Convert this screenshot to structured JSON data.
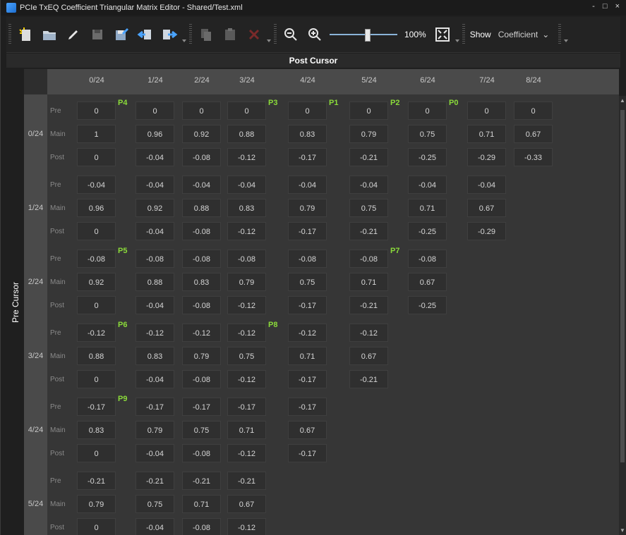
{
  "window": {
    "title": "PCIe TxEQ Coefficient Triangular Matrix Editor - Shared/Test.xml",
    "controls": "- □ ×"
  },
  "toolbar": {
    "icons": [
      "new-icon",
      "open-folder-icon",
      "edit-pencil-icon",
      "save-icon",
      "save-as-icon",
      "import-icon",
      "export-icon",
      "copy-icon",
      "paste-icon",
      "delete-icon",
      "zoom-out-icon",
      "zoom-in-icon",
      "fit-icon"
    ],
    "zoom_percent": "100%",
    "zoom_level": 0.55,
    "show_label": "Show",
    "show_value": "Coefficient"
  },
  "axes": {
    "post_cursor": "Post Cursor",
    "pre_cursor": "Pre Cursor"
  },
  "columns": [
    "0/24",
    "1/24",
    "2/24",
    "3/24",
    "4/24",
    "5/24",
    "6/24",
    "7/24",
    "8/24"
  ],
  "row_labels": [
    "Pre",
    "Main",
    "Post"
  ],
  "rows": [
    {
      "label": "0/24",
      "pre": [
        "0",
        "0",
        "0",
        "0",
        "0",
        "0",
        "0",
        "0",
        "0"
      ],
      "main": [
        "1",
        "0.96",
        "0.92",
        "0.88",
        "0.83",
        "0.79",
        "0.75",
        "0.71",
        "0.67"
      ],
      "post": [
        "0",
        "-0.04",
        "-0.08",
        "-0.12",
        "-0.17",
        "-0.21",
        "-0.25",
        "-0.29",
        "-0.33"
      ]
    },
    {
      "label": "1/24",
      "pre": [
        "-0.04",
        "-0.04",
        "-0.04",
        "-0.04",
        "-0.04",
        "-0.04",
        "-0.04",
        "-0.04"
      ],
      "main": [
        "0.96",
        "0.92",
        "0.88",
        "0.83",
        "0.79",
        "0.75",
        "0.71",
        "0.67"
      ],
      "post": [
        "0",
        "-0.04",
        "-0.08",
        "-0.12",
        "-0.17",
        "-0.21",
        "-0.25",
        "-0.29"
      ]
    },
    {
      "label": "2/24",
      "pre": [
        "-0.08",
        "-0.08",
        "-0.08",
        "-0.08",
        "-0.08",
        "-0.08",
        "-0.08"
      ],
      "main": [
        "0.92",
        "0.88",
        "0.83",
        "0.79",
        "0.75",
        "0.71",
        "0.67"
      ],
      "post": [
        "0",
        "-0.04",
        "-0.08",
        "-0.12",
        "-0.17",
        "-0.21",
        "-0.25"
      ]
    },
    {
      "label": "3/24",
      "pre": [
        "-0.12",
        "-0.12",
        "-0.12",
        "-0.12",
        "-0.12",
        "-0.12"
      ],
      "main": [
        "0.88",
        "0.83",
        "0.79",
        "0.75",
        "0.71",
        "0.67"
      ],
      "post": [
        "0",
        "-0.04",
        "-0.08",
        "-0.12",
        "-0.17",
        "-0.21"
      ]
    },
    {
      "label": "4/24",
      "pre": [
        "-0.17",
        "-0.17",
        "-0.17",
        "-0.17",
        "-0.17"
      ],
      "main": [
        "0.83",
        "0.79",
        "0.75",
        "0.71",
        "0.67"
      ],
      "post": [
        "0",
        "-0.04",
        "-0.08",
        "-0.12",
        "-0.17"
      ]
    },
    {
      "label": "5/24",
      "pre": [
        "-0.21",
        "-0.21",
        "-0.21",
        "-0.21"
      ],
      "main": [
        "0.79",
        "0.75",
        "0.71",
        "0.67"
      ],
      "post": [
        "0",
        "-0.04",
        "-0.08",
        "-0.12"
      ]
    }
  ],
  "presets": [
    {
      "name": "P4",
      "row": 0,
      "col": 0
    },
    {
      "name": "P3",
      "row": 0,
      "col": 3
    },
    {
      "name": "P1",
      "row": 0,
      "col": 4
    },
    {
      "name": "P2",
      "row": 0,
      "col": 5
    },
    {
      "name": "P0",
      "row": 0,
      "col": 6
    },
    {
      "name": "P5",
      "row": 2,
      "col": 0
    },
    {
      "name": "P7",
      "row": 2,
      "col": 5
    },
    {
      "name": "P6",
      "row": 3,
      "col": 0
    },
    {
      "name": "P8",
      "row": 3,
      "col": 3
    },
    {
      "name": "P9",
      "row": 4,
      "col": 0
    }
  ]
}
